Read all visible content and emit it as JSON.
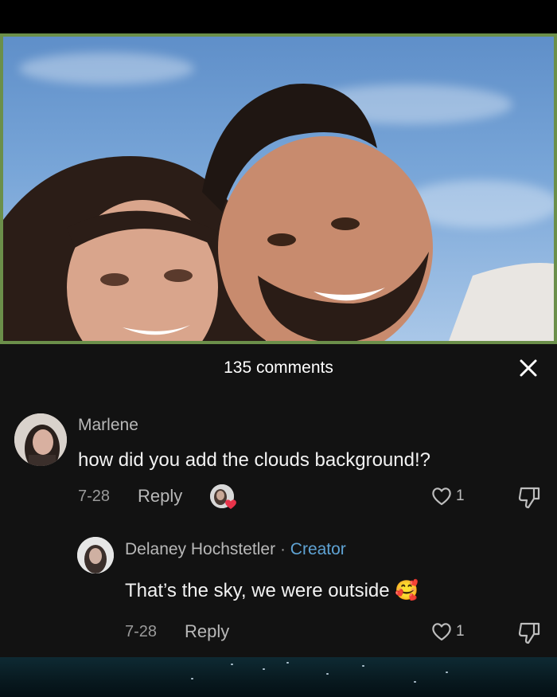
{
  "header": {
    "comment_count": "135 comments"
  },
  "comments": [
    {
      "username": "Marlene",
      "text": "how did you add the clouds background!?",
      "date": "7-28",
      "reply_label": "Reply",
      "likes": "1"
    },
    {
      "username": "Delaney Hochstetler",
      "separator": "·",
      "badge": "Creator",
      "text": "That’s the sky, we were outside",
      "emoji": "🥰",
      "date": "7-28",
      "reply_label": "Reply",
      "likes": "1"
    }
  ],
  "colors": {
    "frame": "#6b8f4a",
    "creator": "#5fa3d4",
    "liked_heart": "#e8334a"
  }
}
